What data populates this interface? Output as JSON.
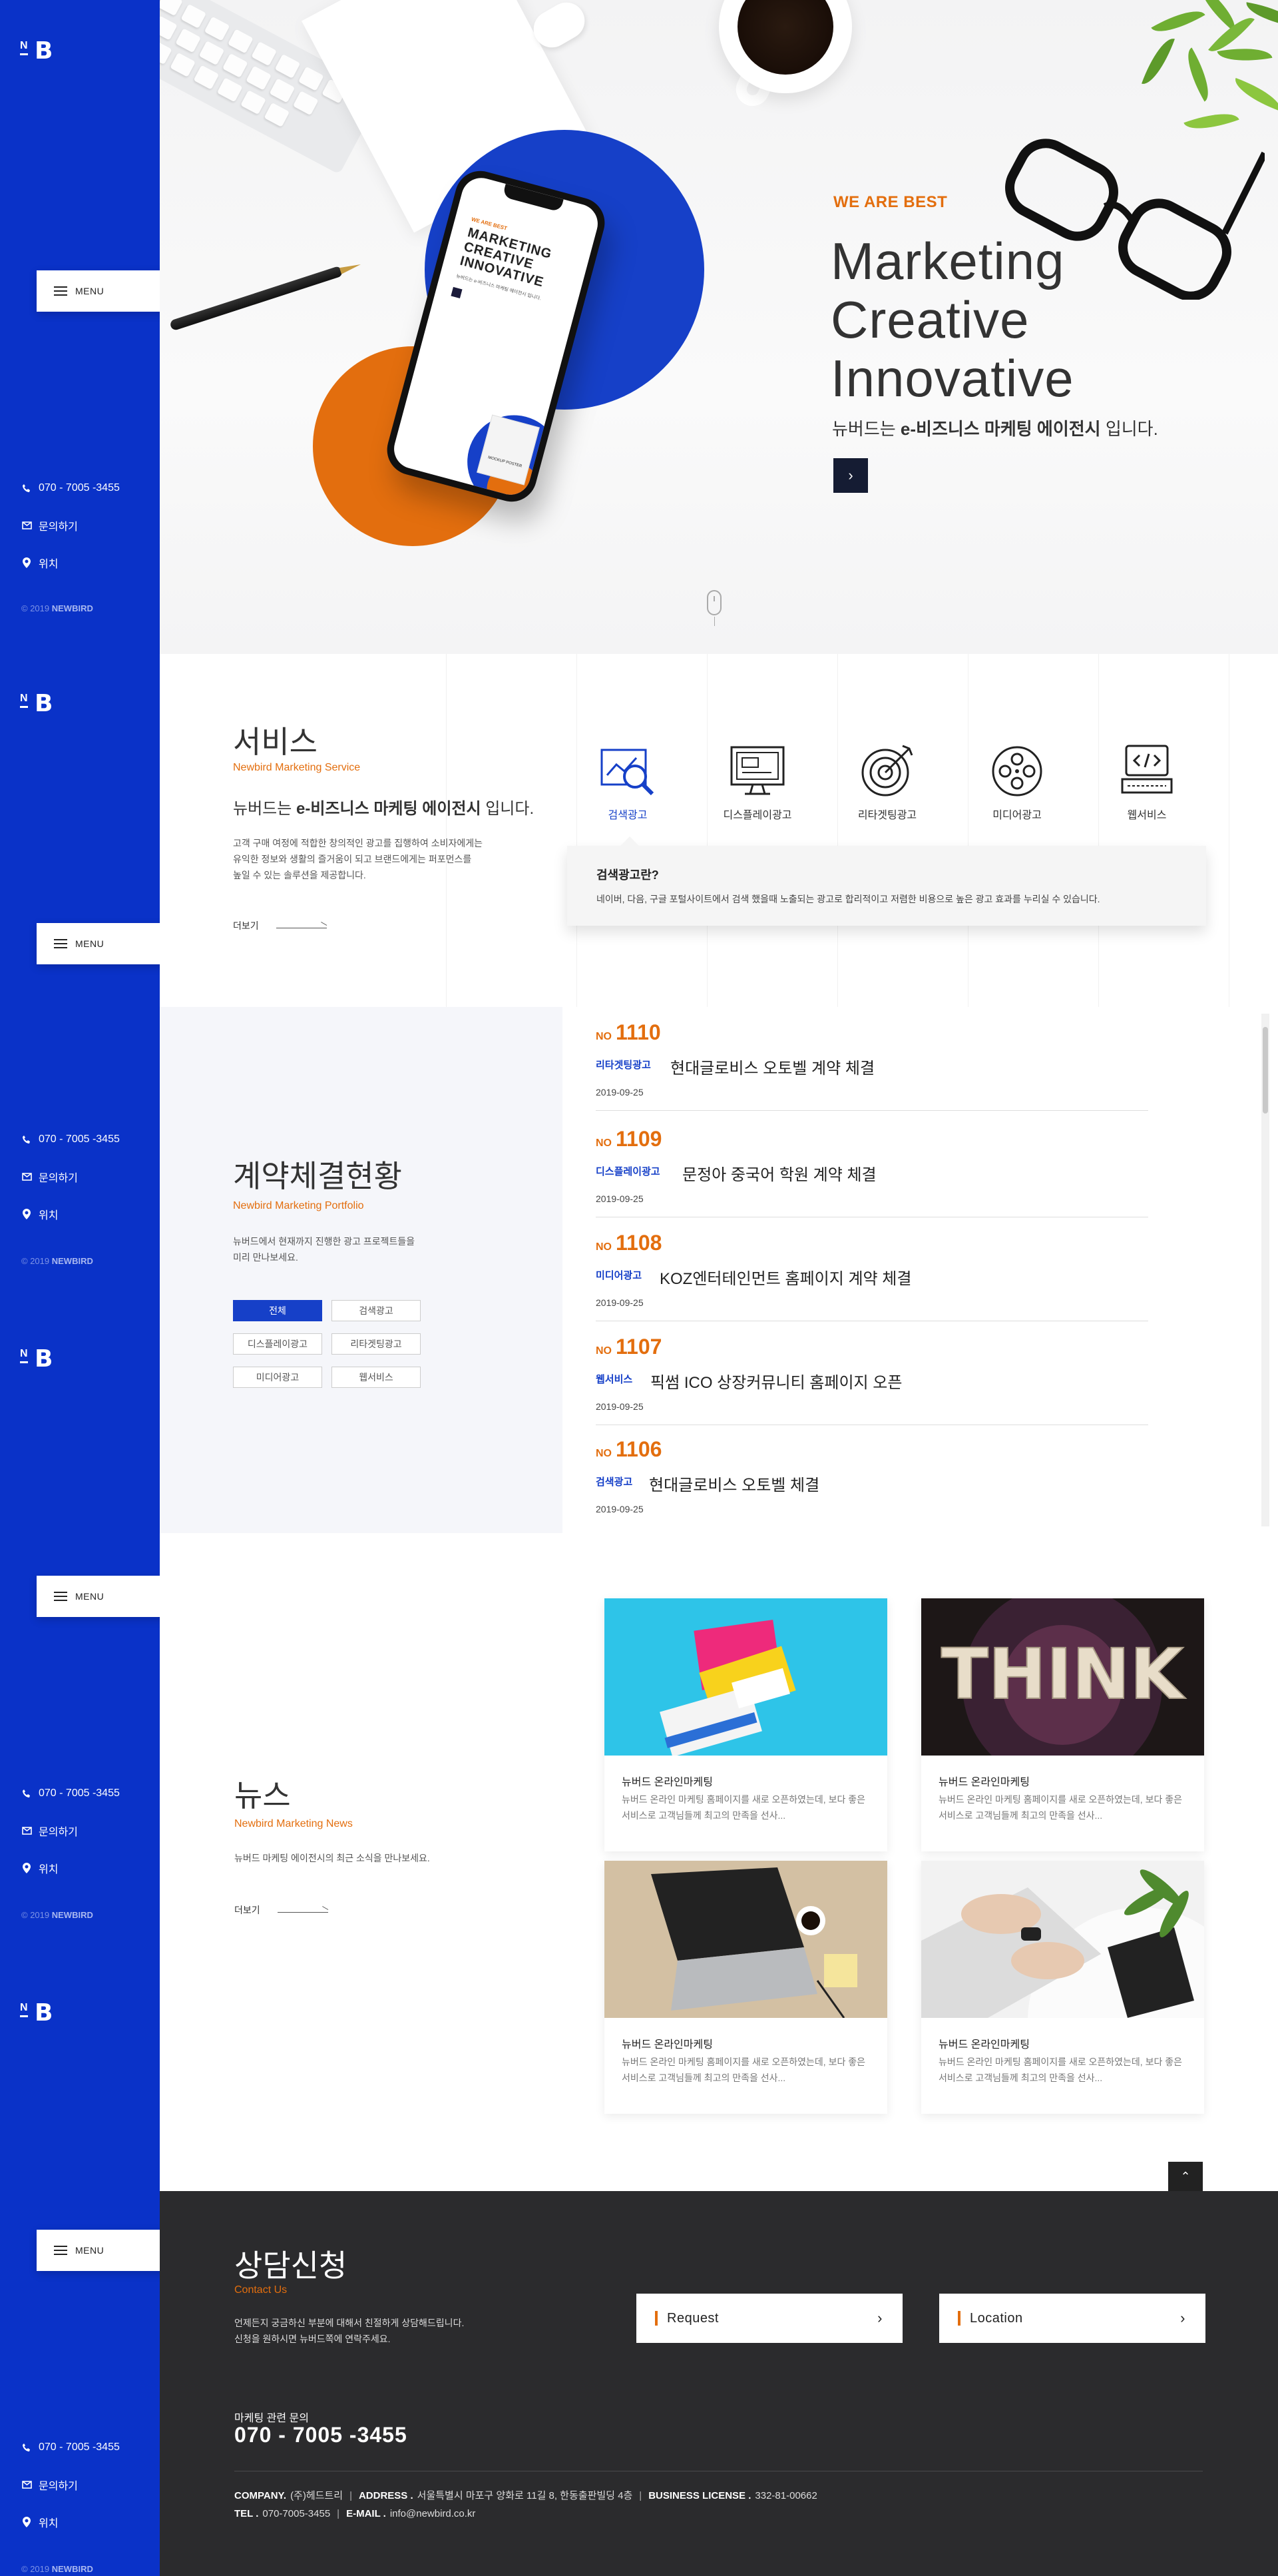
{
  "brand": {
    "logo_n": "N",
    "logo_b": "B"
  },
  "sidebar": {
    "menu_label": "MENU",
    "phone": "070 - 7005 -3455",
    "inquiry": "문의하기",
    "location": "위치",
    "copyright_year": "© 2019",
    "copyright_brand": "NEWBIRD"
  },
  "hero": {
    "subtitle": "WE ARE BEST",
    "title_line1": "Marketing",
    "title_line2": "Creative",
    "title_line3": "Innovative",
    "desc_prefix": "뉴버드는 ",
    "desc_bold": "e-비즈니스 마케팅 에이전시",
    "desc_suffix": " 입니다.",
    "arrow": "›",
    "phone_screen": {
      "kicker": "WE ARE BEST",
      "title": "MARKETING CREATIVE INNOVATIVE",
      "desc": "뉴버드는 e-비즈니스 마케팅 에이전시 입니다.",
      "poster": "MOCKUP POSTER"
    }
  },
  "services": {
    "title": "서비스",
    "subtitle": "Newbird Marketing Service",
    "lead_prefix": "뉴버드는 ",
    "lead_bold": "e-비즈니스 마케팅 에이전시",
    "lead_suffix": " 입니다.",
    "desc_line1": "고객 구매 여정에 적합한 창의적인 광고를 집행하여 소비자에게는",
    "desc_line2": "유익한 정보와 생활의 즐거움이 되고 브랜드에게는 퍼포먼스를",
    "desc_line3": "높일 수 있는 솔루션을 제공합니다.",
    "more": "더보기",
    "items": [
      {
        "label": "검색광고",
        "icon": "search-ad-icon"
      },
      {
        "label": "디스플레이광고",
        "icon": "display-ad-icon"
      },
      {
        "label": "리타겟팅광고",
        "icon": "target-icon"
      },
      {
        "label": "미디어광고",
        "icon": "media-reel-icon"
      },
      {
        "label": "웹서비스",
        "icon": "web-code-icon"
      }
    ],
    "active_index": 0,
    "box_question": "검색광고란?",
    "box_answer": "네이버, 다음, 구글 포털사이트에서 검색 했을때 노출되는 광고로 합리적이고 저렴한 비용으로 높은 광고 효과를 누리실 수 있습니다."
  },
  "portfolio": {
    "title": "계약체결현황",
    "subtitle": "Newbird Marketing Portfolio",
    "desc_line1": "뉴버드에서 현재까지 진행한 광고 프로젝트들을",
    "desc_line2": "미리 만나보세요.",
    "filters": [
      "전체",
      "검색광고",
      "디스플레이광고",
      "리타겟팅광고",
      "미디어광고",
      "웹서비스"
    ],
    "active_filter": 0,
    "no_prefix": "NO",
    "items": [
      {
        "no": "1110",
        "category": "리타겟팅광고",
        "title": "현대글로비스 오토벨 계약 체결",
        "date": "2019-09-25"
      },
      {
        "no": "1109",
        "category": "디스플레이광고",
        "title": "문정아 중국어 학원 계약 체결",
        "date": "2019-09-25"
      },
      {
        "no": "1108",
        "category": "미디어광고",
        "title": "KOZ엔터테인먼트 홈페이지 계약 체결",
        "date": "2019-09-25"
      },
      {
        "no": "1107",
        "category": "웹서비스",
        "title": "픽썸 ICO 상장커뮤니티 홈페이지 오픈",
        "date": "2019-09-25"
      },
      {
        "no": "1106",
        "category": "검색광고",
        "title": "현대글로비스 오토벨 체결",
        "date": "2019-09-25"
      }
    ]
  },
  "news": {
    "title": "뉴스",
    "subtitle": "Newbird Marketing News",
    "desc": "뉴버드 마케팅 에이전시의 최근 소식을 만나보세요.",
    "more": "더보기",
    "cards": [
      {
        "title": "뉴버드 온라인마케팅",
        "desc": "뉴버드 온라인 마케팅 홈페이지를 새로 오픈하였는데, 보다 좋은 서비스로 고객님들께 최고의 만족을 선사...",
        "image": "colorful-boxes-photo"
      },
      {
        "title": "뉴버드 온라인마케팅",
        "desc": "뉴버드 온라인 마케팅 홈페이지를 새로 오픈하였는데, 보다 좋은 서비스로 고객님들께 최고의 만족을 선사...",
        "image": "think-letters-photo"
      },
      {
        "title": "뉴버드 온라인마케팅",
        "desc": "뉴버드 온라인 마케팅 홈페이지를 새로 오픈하였는데, 보다 좋은 서비스로 고객님들께 최고의 만족을 선사...",
        "image": "laptop-desk-photo"
      },
      {
        "title": "뉴버드 온라인마케팅",
        "desc": "뉴버드 온라인 마케팅 홈페이지를 새로 오픈하였는데, 보다 좋은 서비스로 고객님들께 최고의 만족을 선사...",
        "image": "typing-hands-photo"
      }
    ],
    "to_top": "⌃"
  },
  "contact": {
    "title": "상담신청",
    "subtitle": "Contact Us",
    "desc_line1": "언제든지 궁금하신 부분에 대해서 친절하게 상담해드립니다.",
    "desc_line2": "신청을 원하시면 뉴버드쪽에 연락주세요.",
    "request_label": "Request",
    "location_label": "Location",
    "phone_label": "마케팅 관련 문의",
    "phone": "070 - 7005 -3455",
    "company_label": "COMPANY.",
    "company": "(주)헤드트리",
    "address_label": "ADDRESS .",
    "address": "서울특별시 마포구 양화로 11길 8, 한동출판빌딩 4층",
    "license_label": "BUSINESS LICENSE .",
    "license": "332-81-00662",
    "tel_label": "TEL .",
    "tel": "070-7005-3455",
    "email_label": "E-MAIL .",
    "email": "info@newbird.co.kr"
  },
  "colors": {
    "primary": "#0a32c8",
    "accent": "#e36e0e",
    "dark": "#2b2b2d",
    "navy": "#151c33"
  }
}
